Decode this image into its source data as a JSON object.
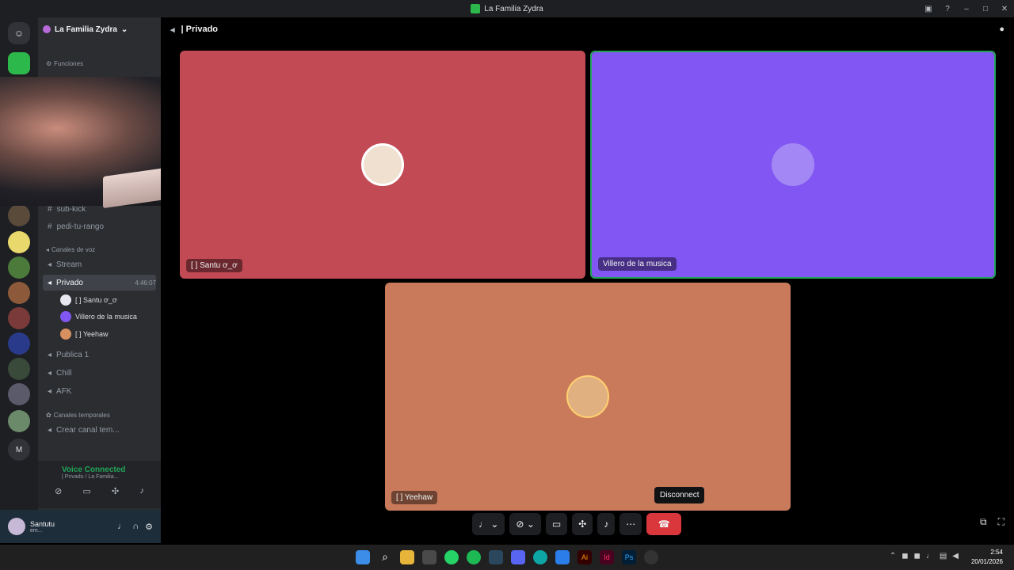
{
  "window": {
    "title": "La Familia Zydra"
  },
  "server": {
    "name": "La Familia Zydra"
  },
  "sidebar": {
    "category_funciones": "Funciones",
    "text_channels": [
      {
        "name": "sub-kick"
      },
      {
        "name": "pedi-tu-rango"
      }
    ],
    "category_voz": "Canales de voz",
    "voice_channels": [
      {
        "name": "Stream"
      },
      {
        "name": "Privado",
        "time": "4:46:07"
      },
      {
        "name": "Publica 1"
      },
      {
        "name": "Chill"
      },
      {
        "name": "AFK"
      }
    ],
    "voice_users": [
      {
        "name": "[ ] Santu ơ_ơ"
      },
      {
        "name": "Villero de la musica"
      },
      {
        "name": "[ ] Yeehaw"
      }
    ],
    "category_temp": "Canales temporales",
    "temp_channel": "Crear canal tem..."
  },
  "voice_status": {
    "title": "Voice Connected",
    "subtitle": "| Privado / La Familia..."
  },
  "user": {
    "name": "Santutu",
    "status": "em..."
  },
  "main": {
    "channel_title": "| Privado"
  },
  "tiles": [
    {
      "name": "[ ] Santu ơ_ơ",
      "color": "#c24a55"
    },
    {
      "name": "Villero de la musica",
      "color": "#8156f2"
    },
    {
      "name": "[ ] Yeehaw",
      "color": "#c97a5a"
    }
  ],
  "controls": {
    "disconnect_tooltip": "Disconnect"
  },
  "taskbar": {
    "time": "2:54",
    "date": "20/01/2026"
  },
  "colors": {
    "accent_green": "#23a559",
    "danger": "#da373c"
  }
}
